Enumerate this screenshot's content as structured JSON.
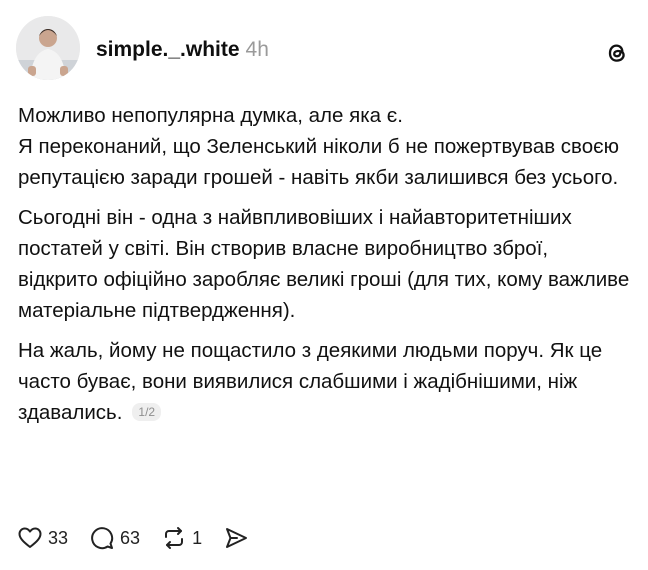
{
  "post": {
    "username": "simple._.white",
    "time": "4h",
    "paragraphs": [
      "Можливо непопулярна думка, але яка є.\nЯ переконаний, що Зеленський ніколи б не пожертвував своєю репутацією заради грошей - навіть якби залишився без усього.",
      "Сьогодні він - одна з найвпливовіших і найавторитетніших постатей у світі. Він створив власне виробництво зброї, відкрито офіційно заробляє великі гроші (для тих, кому важливе матеріальне підтвердження).",
      "На жаль, йому не пощастило з деякими людьми поруч. Як це часто буває, вони виявилися слабшими і жадібнішими, ніж здавались."
    ],
    "page_indicator": "1/2"
  },
  "actions": {
    "likes": "33",
    "comments": "63",
    "reposts": "1"
  },
  "icons": {
    "like": "heart-icon",
    "comment": "comment-bubble-icon",
    "repost": "repost-icon",
    "share": "send-icon",
    "brand": "threads-logo-icon"
  }
}
